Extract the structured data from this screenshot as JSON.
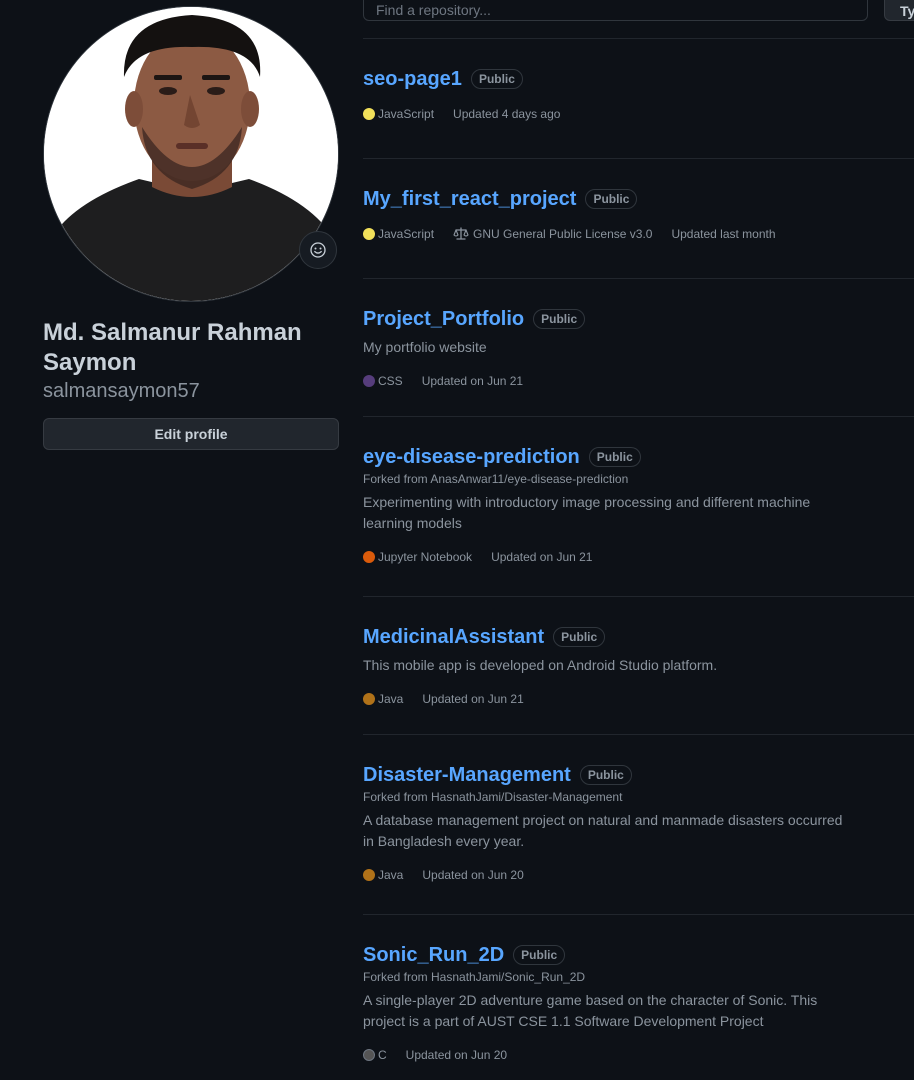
{
  "profile": {
    "full_name": "Md. Salmanur Rahman Saymon",
    "username": "salmansaymon57",
    "edit_label": "Edit profile",
    "status_icon": "smiley-icon"
  },
  "toolbar": {
    "search_placeholder": "Find a repository...",
    "type_label": "Ty"
  },
  "colors": {
    "JavaScript": "#f1e05a",
    "CSS": "#563d7c",
    "Jupyter Notebook": "#da5b0b",
    "Java": "#b07219",
    "C": "#555555"
  },
  "repos": [
    {
      "name": "seo-page1",
      "visibility": "Public",
      "language": "JavaScript",
      "updated": "Updated 4 days ago"
    },
    {
      "name": "My_first_react_project",
      "visibility": "Public",
      "language": "JavaScript",
      "license": "GNU General Public License v3.0",
      "updated": "Updated last month"
    },
    {
      "name": "Project_Portfolio",
      "visibility": "Public",
      "description": "My portfolio website",
      "language": "CSS",
      "updated": "Updated on Jun 21"
    },
    {
      "name": "eye-disease-prediction",
      "visibility": "Public",
      "fork_prefix": "Forked from ",
      "fork_source": "AnasAnwar11/eye-disease-prediction",
      "description": "Experimenting with introductory image processing and different machine learning models",
      "language": "Jupyter Notebook",
      "updated": "Updated on Jun 21"
    },
    {
      "name": "MedicinalAssistant",
      "visibility": "Public",
      "description": "This mobile app is developed on Android Studio platform.",
      "language": "Java",
      "updated": "Updated on Jun 21"
    },
    {
      "name": "Disaster-Management",
      "visibility": "Public",
      "fork_prefix": "Forked from ",
      "fork_source": "HasnathJami/Disaster-Management",
      "description": "A database management project on natural and manmade disasters occurred in Bangladesh every year.",
      "language": "Java",
      "updated": "Updated on Jun 20"
    },
    {
      "name": "Sonic_Run_2D",
      "visibility": "Public",
      "fork_prefix": "Forked from ",
      "fork_source": "HasnathJami/Sonic_Run_2D",
      "description": "A single-player 2D adventure game based on the character of Sonic. This project is a part of AUST CSE 1.1 Software Development Project",
      "language": "C",
      "updated": "Updated on Jun 20"
    }
  ]
}
